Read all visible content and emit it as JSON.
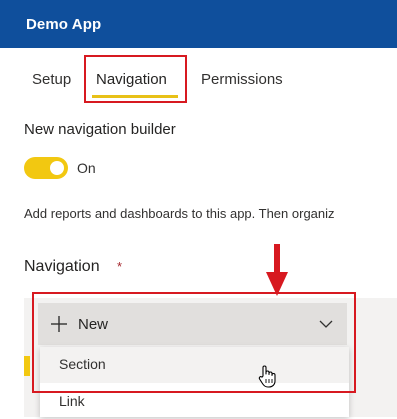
{
  "app": {
    "title": "Demo App"
  },
  "tabs": [
    {
      "label": "Setup",
      "selected": false
    },
    {
      "label": "Navigation",
      "selected": true
    },
    {
      "label": "Permissions",
      "selected": false
    }
  ],
  "builder": {
    "label": "New navigation builder",
    "toggle_state": "On",
    "toggle_on": true
  },
  "description": "Add reports and dashboards to this app. Then organiz",
  "navigation": {
    "heading": "Navigation",
    "required_marker": "*",
    "new_button_label": "New",
    "menu_items": [
      {
        "label": "Section",
        "hovered": true
      },
      {
        "label": "Link",
        "hovered": false
      }
    ]
  },
  "icons": {
    "plus": "plus-icon",
    "chevron": "chevron-down-icon",
    "arrow": "arrow-down-icon",
    "cursor": "hand-pointer-icon"
  },
  "colors": {
    "header_bg": "#0f4f9c",
    "accent_yellow": "#f2c811",
    "highlight_red": "#d71920",
    "required_red": "#a4262c",
    "button_gray": "#e1dfdd"
  }
}
